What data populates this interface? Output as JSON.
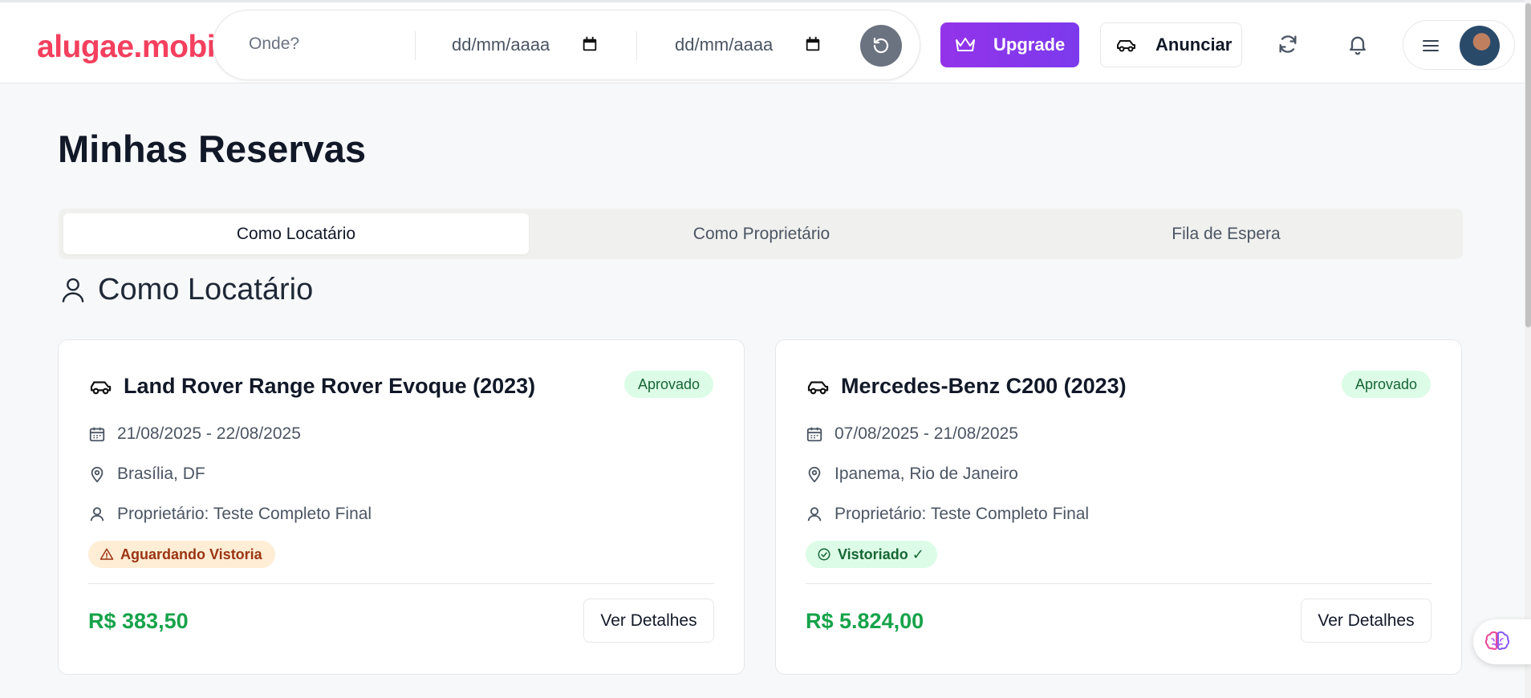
{
  "header": {
    "logo": "alugae.mobi",
    "search": {
      "where_placeholder": "Onde?",
      "start_date_placeholder": "dd/mm/aaaa",
      "end_date_placeholder": "dd/mm/aaaa"
    },
    "upgrade_label": "Upgrade",
    "announce_label": "Anunciar"
  },
  "page": {
    "title": "Minhas Reservas",
    "tabs": [
      {
        "label": "Como Locatário",
        "active": true
      },
      {
        "label": "Como Proprietário",
        "active": false
      },
      {
        "label": "Fila de Espera",
        "active": false
      }
    ],
    "section_title": "Como Locatário"
  },
  "reservations": [
    {
      "vehicle": "Land Rover Range Rover Evoque (2023)",
      "status": "Aprovado",
      "dates": "21/08/2025 - 22/08/2025",
      "location": "Brasília, DF",
      "owner": "Proprietário: Teste Completo Final",
      "inspection": "Aguardando Vistoria",
      "price": "R$ 383,50",
      "details_label": "Ver Detalhes"
    },
    {
      "vehicle": "Mercedes-Benz C200 (2023)",
      "status": "Aprovado",
      "dates": "07/08/2025 - 21/08/2025",
      "location": "Ipanema, Rio de Janeiro",
      "owner": "Proprietário: Teste Completo Final",
      "inspection": "Vistoriado ✓",
      "price": "R$ 5.824,00",
      "details_label": "Ver Detalhes"
    }
  ],
  "colors": {
    "brand": "#f43f5e",
    "upgrade": "#9333ea",
    "price": "#16a34a",
    "status_bg": "#dcfce7",
    "warn_bg": "#ffedd5"
  }
}
